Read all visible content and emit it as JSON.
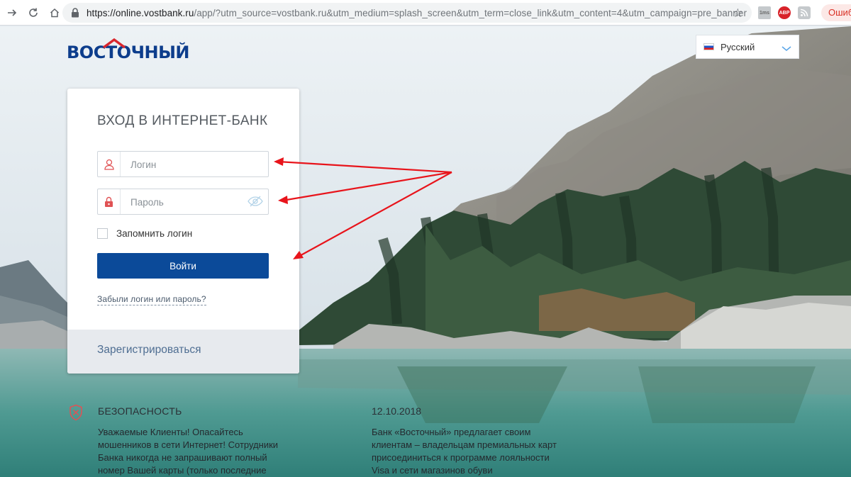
{
  "browser": {
    "back_icon": "arrow-right-icon",
    "reload_icon": "reload-icon",
    "home_icon": "home-icon",
    "url_host": "https://online.vostbank.ru",
    "url_rest": "/app/?utm_source=vostbank.ru&utm_medium=splash_screen&utm_term=close_link&utm_content=4&utm_campaign=pre_banner",
    "extensions": {
      "abp_label": "ABP",
      "mini_label": "1ms"
    },
    "error_label": "Ошибк"
  },
  "header": {
    "logo_text": "ВОСТОЧНЫЙ",
    "language": {
      "label": "Русский",
      "flag": "russia-flag"
    }
  },
  "login": {
    "title": "ВХОД В ИНТЕРНЕТ-БАНК",
    "login_placeholder": "Логин",
    "password_placeholder": "Пароль",
    "remember_label": "Запомнить логин",
    "submit_label": "Войти",
    "forgot_label": "Забыли логин или пароль?",
    "register_label": "Зарегистрироваться"
  },
  "security": {
    "title": "БЕЗОПАСНОСТЬ",
    "text": "Уважаемые Клиенты! Опасайтесь мошенников в сети Интернет! Сотрудники Банка никогда не запрашивают полный номер Вашей карты (только последние"
  },
  "news": {
    "date": "12.10.2018",
    "text": "Банк «Восточный» предлагает своим клиентам – владельцам премиальных карт присоединиться к программе лояльности Visa и сети магазинов обуви"
  },
  "colors": {
    "brand_blue": "#0b4a99",
    "logo_blue": "#0d3d8c",
    "logo_red": "#d9272e",
    "annotation_red": "#e8141b"
  }
}
